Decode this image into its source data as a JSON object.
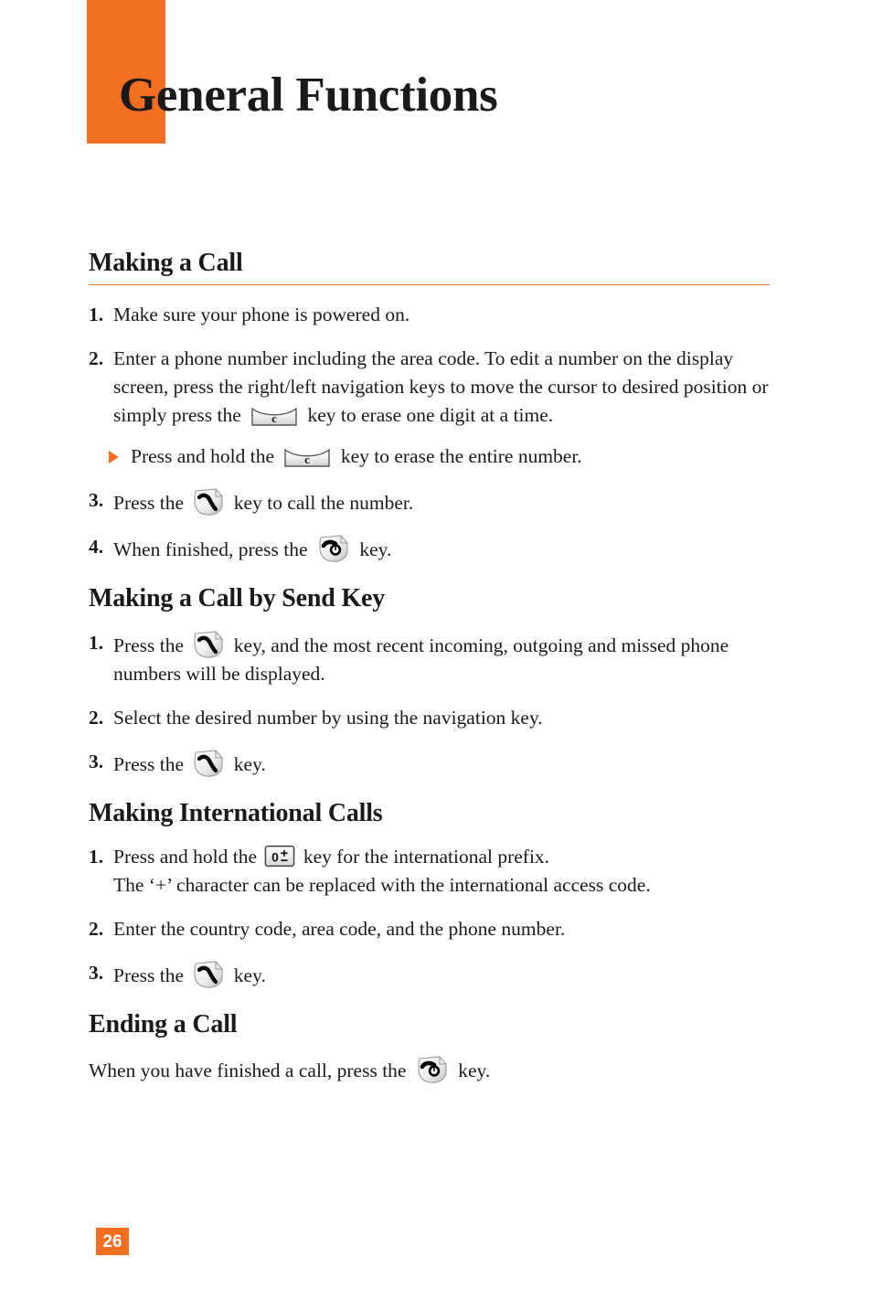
{
  "page": {
    "title": "General Functions",
    "number": "26",
    "accent_color": "#F26F21",
    "rule_color": "#E8761F"
  },
  "icons": {
    "clear_key": "clear-c-key-icon",
    "send_key": "send-call-key-icon",
    "end_key": "end-call-key-icon",
    "zero_plus_key": "zero-plus-key-icon",
    "bullet": "orange-triangle-bullet-icon"
  },
  "sections": [
    {
      "id": "making-a-call",
      "heading": "Making a Call",
      "ruled": true,
      "steps": [
        {
          "num": "1.",
          "parts": [
            {
              "type": "text",
              "value": "Make sure your phone is powered on."
            }
          ]
        },
        {
          "num": "2.",
          "parts": [
            {
              "type": "text",
              "value": "Enter a phone number including the area code. To edit a number on the display screen, press the right/left navigation keys to move the cursor to desired position or simply press the"
            },
            {
              "type": "icon",
              "value": "clear_key"
            },
            {
              "type": "text",
              "value": "key to erase one digit at a time."
            }
          ]
        }
      ],
      "sub_bullet": {
        "parts": [
          {
            "type": "text",
            "value": "Press and hold the"
          },
          {
            "type": "icon",
            "value": "clear_key"
          },
          {
            "type": "text",
            "value": "key to erase the entire number."
          }
        ]
      },
      "steps_after": [
        {
          "num": "3.",
          "parts": [
            {
              "type": "text",
              "value": "Press the"
            },
            {
              "type": "icon",
              "value": "send_key"
            },
            {
              "type": "text",
              "value": "key to call the number."
            }
          ]
        },
        {
          "num": "4.",
          "parts": [
            {
              "type": "text",
              "value": "When finished, press the"
            },
            {
              "type": "icon",
              "value": "end_key"
            },
            {
              "type": "text",
              "value": "key."
            }
          ]
        }
      ]
    },
    {
      "id": "making-a-call-by-send-key",
      "heading": "Making a Call by Send Key",
      "ruled": false,
      "steps": [
        {
          "num": "1.",
          "parts": [
            {
              "type": "text",
              "value": "Press the"
            },
            {
              "type": "icon",
              "value": "send_key"
            },
            {
              "type": "text",
              "value": "key, and the most recent incoming, outgoing and missed phone numbers will be displayed."
            }
          ]
        },
        {
          "num": "2.",
          "parts": [
            {
              "type": "text",
              "value": "Select the desired number by using the navigation key."
            }
          ]
        },
        {
          "num": "3.",
          "parts": [
            {
              "type": "text",
              "value": "Press the"
            },
            {
              "type": "icon",
              "value": "send_key"
            },
            {
              "type": "text",
              "value": "key."
            }
          ]
        }
      ]
    },
    {
      "id": "making-international-calls",
      "heading": "Making International Calls",
      "ruled": false,
      "steps": [
        {
          "num": "1.",
          "parts": [
            {
              "type": "text",
              "value": "Press and hold the"
            },
            {
              "type": "icon",
              "value": "zero_plus_key"
            },
            {
              "type": "text",
              "value": "key for the international prefix."
            },
            {
              "type": "break"
            },
            {
              "type": "text",
              "value": "The ‘+’ character can be replaced with the international access code."
            }
          ]
        },
        {
          "num": "2.",
          "parts": [
            {
              "type": "text",
              "value": "Enter the country code, area code, and the phone number."
            }
          ]
        },
        {
          "num": "3.",
          "parts": [
            {
              "type": "text",
              "value": "Press the"
            },
            {
              "type": "icon",
              "value": "send_key"
            },
            {
              "type": "text",
              "value": "key."
            }
          ]
        }
      ]
    },
    {
      "id": "ending-a-call",
      "heading": "Ending a Call",
      "ruled": false,
      "paragraph": {
        "parts": [
          {
            "type": "text",
            "value": "When you have finished a call, press the"
          },
          {
            "type": "icon",
            "value": "end_key"
          },
          {
            "type": "text",
            "value": "key."
          }
        ]
      }
    }
  ],
  "text": {
    "title": "General Functions",
    "page_number": "26",
    "s1_heading": "Making a Call",
    "s1_step1_num": "1.",
    "s1_step1": "Make sure your phone is powered on.",
    "s1_step2_num": "2.",
    "s1_step2_a": "Enter a phone number including the area code. To edit a number on the display screen, press the right/left navigation keys to move the cursor to desired position or simply press the",
    "s1_step2_b": "key to erase one digit at a time.",
    "s1_bullet_a": "Press and hold the",
    "s1_bullet_b": "key to erase the entire number.",
    "s1_step3_num": "3.",
    "s1_step3_a": "Press the",
    "s1_step3_b": "key to call the number.",
    "s1_step4_num": "4.",
    "s1_step4_a": "When finished, press the",
    "s1_step4_b": "key.",
    "s2_heading": "Making a Call by Send Key",
    "s2_step1_num": "1.",
    "s2_step1_a": "Press the",
    "s2_step1_b": "key, and the most recent incoming, outgoing and missed phone numbers will be displayed.",
    "s2_step2_num": "2.",
    "s2_step2": "Select the desired number by using the navigation key.",
    "s2_step3_num": "3.",
    "s2_step3_a": "Press the",
    "s2_step3_b": "key.",
    "s3_heading": "Making International Calls",
    "s3_step1_num": "1.",
    "s3_step1_a": "Press and hold the",
    "s3_step1_b": "key for the international prefix.",
    "s3_step1_c": "The ‘+’ character can be replaced with the international access code.",
    "s3_step2_num": "2.",
    "s3_step2": "Enter the country code, area code, and the phone number.",
    "s3_step3_num": "3.",
    "s3_step3_a": "Press the",
    "s3_step3_b": "key.",
    "s4_heading": "Ending a Call",
    "s4_para_a": "When you have finished a call, press the",
    "s4_para_b": "key.",
    "key_c_label": "c",
    "key_zero_label": "0"
  }
}
